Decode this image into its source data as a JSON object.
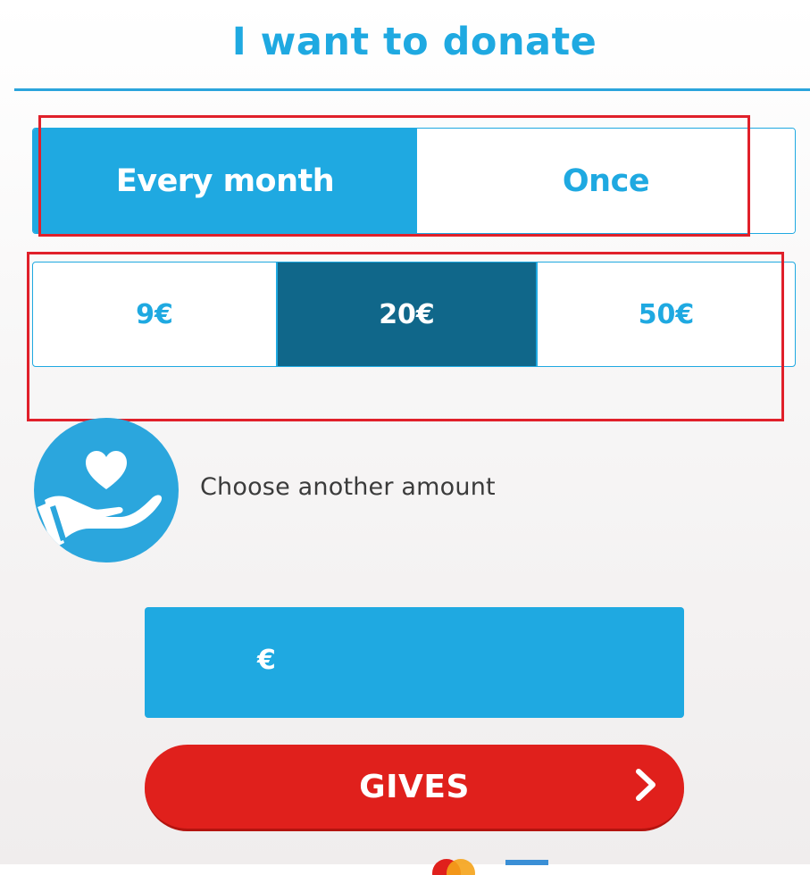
{
  "page": {
    "title": "I want to donate"
  },
  "frequency": {
    "options": [
      {
        "label": "Every month",
        "selected": true
      },
      {
        "label": "Once",
        "selected": false
      }
    ]
  },
  "amounts": {
    "options": [
      {
        "label": "9€",
        "selected": false
      },
      {
        "label": "20€",
        "selected": true
      },
      {
        "label": "50€",
        "selected": false
      }
    ]
  },
  "other_amount": {
    "label": "Choose another amount",
    "icon": "hand-heart-icon",
    "currency_symbol": "€",
    "value": ""
  },
  "submit": {
    "label": "GIVES",
    "icon": "chevron-right-icon"
  },
  "payment_icons": [
    "mastercard-icon",
    "amex-icon"
  ],
  "colors": {
    "accent": "#1fa9e1",
    "selected_amount": "#10678a",
    "submit": "#e0201c",
    "highlight_box": "#e0202a"
  }
}
